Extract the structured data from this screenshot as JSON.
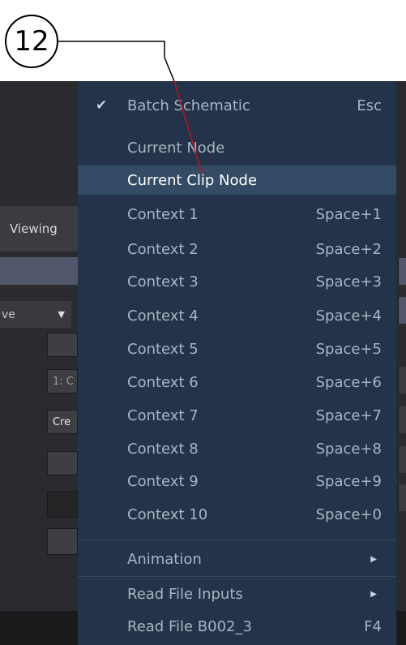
{
  "callout": {
    "number": "12"
  },
  "background": {
    "viewing_tab": "Viewing",
    "mode_select": "ve",
    "stub_1": "1: C",
    "stub_2": "Cre"
  },
  "menu": {
    "items": [
      {
        "label": "Batch Schematic",
        "shortcut": "Esc",
        "checked": true
      },
      {
        "label": "Current Node",
        "shortcut": ""
      },
      {
        "label": "Current Clip Node",
        "shortcut": "",
        "highlighted": true
      },
      {
        "label": "Context 1",
        "shortcut": "Space+1"
      },
      {
        "label": "Context 2",
        "shortcut": "Space+2"
      },
      {
        "label": "Context 3",
        "shortcut": "Space+3"
      },
      {
        "label": "Context 4",
        "shortcut": "Space+4"
      },
      {
        "label": "Context 5",
        "shortcut": "Space+5"
      },
      {
        "label": "Context 6",
        "shortcut": "Space+6"
      },
      {
        "label": "Context 7",
        "shortcut": "Space+7"
      },
      {
        "label": "Context 8",
        "shortcut": "Space+8"
      },
      {
        "label": "Context 9",
        "shortcut": "Space+9"
      },
      {
        "label": "Context 10",
        "shortcut": "Space+0"
      },
      {
        "label": "Animation",
        "submenu": true
      },
      {
        "label": "Read File Inputs",
        "submenu": true
      },
      {
        "label": "Read File B002_3",
        "shortcut": "F4"
      }
    ]
  },
  "icons": {
    "check": "checkmark-icon",
    "submenu": "submenu-arrow-icon",
    "dropdown": "caret-down-icon"
  },
  "colors": {
    "menu_bg": "#23344a",
    "menu_highlight": "#334b64",
    "menu_text": "#a9b4c2",
    "app_bg": "#2a2b2e",
    "callout_line": "#c0121a"
  }
}
